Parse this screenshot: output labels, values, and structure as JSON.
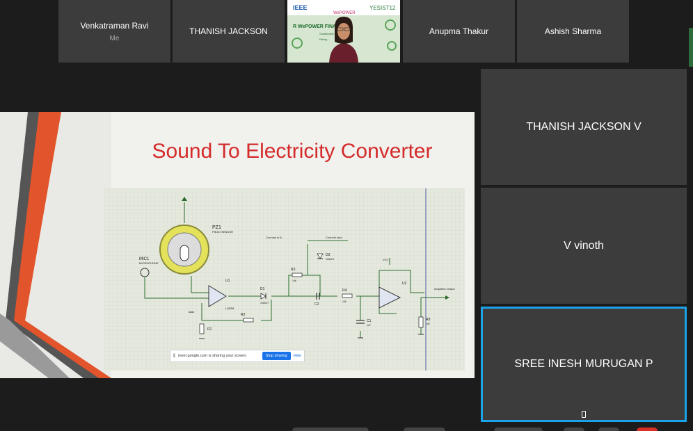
{
  "participants_top": [
    {
      "name": "Venkatraman Ravi",
      "sub": "Me"
    },
    {
      "name": "THANISH JACKSON",
      "sub": ""
    },
    {
      "name": "Anupma Thakur",
      "sub": ""
    },
    {
      "name": "Ashish Sharma",
      "sub": ""
    }
  ],
  "video_tile": {
    "logos": [
      "IEEE",
      "WePOWER",
      "YESIST12"
    ],
    "banner": "R WePOWER FINALS",
    "caption": "Sustainable ... We",
    "caption2": "Rising ..."
  },
  "slide": {
    "title": "Sound To Electricity Converter",
    "labels": {
      "pz1": "PZ1",
      "pz1_sub": "PIEZO SENSOR",
      "mic1": "MIC1",
      "mic1_sub": "MICROPHONE",
      "u1": "U1",
      "u1_part": "LM358",
      "d1": "D1",
      "d1_part": "1N4007",
      "d3": "D3",
      "d3_part": "1N4001",
      "r1": "R1",
      "r2": "R2",
      "r3": "R3",
      "r3_val": "10k",
      "r4": "R4",
      "r4_val": "10k",
      "r8": "R8",
      "r8_val": "10k",
      "c1": "C1",
      "c1_val": "1uF",
      "c2": "C2",
      "u2": "U2",
      "vcc": "VCC",
      "connect_to_A": "Connect to A",
      "connect_load": "Connect load",
      "amplified_output": "Amplified Output"
    }
  },
  "share_bar": {
    "message": "meet.google.com is sharing your screen.",
    "stop_label": "Stop sharing",
    "hide_label": "Hide"
  },
  "participants_side": [
    {
      "name": "THANISH JACKSON V",
      "active": false
    },
    {
      "name": "V vinoth",
      "active": false
    },
    {
      "name": "SREE INESH MURUGAN P",
      "active": true
    }
  ],
  "colors": {
    "accent_active": "#1aa3e8",
    "title_red": "#d42a2a",
    "tile_bg": "#3c3c3c"
  }
}
